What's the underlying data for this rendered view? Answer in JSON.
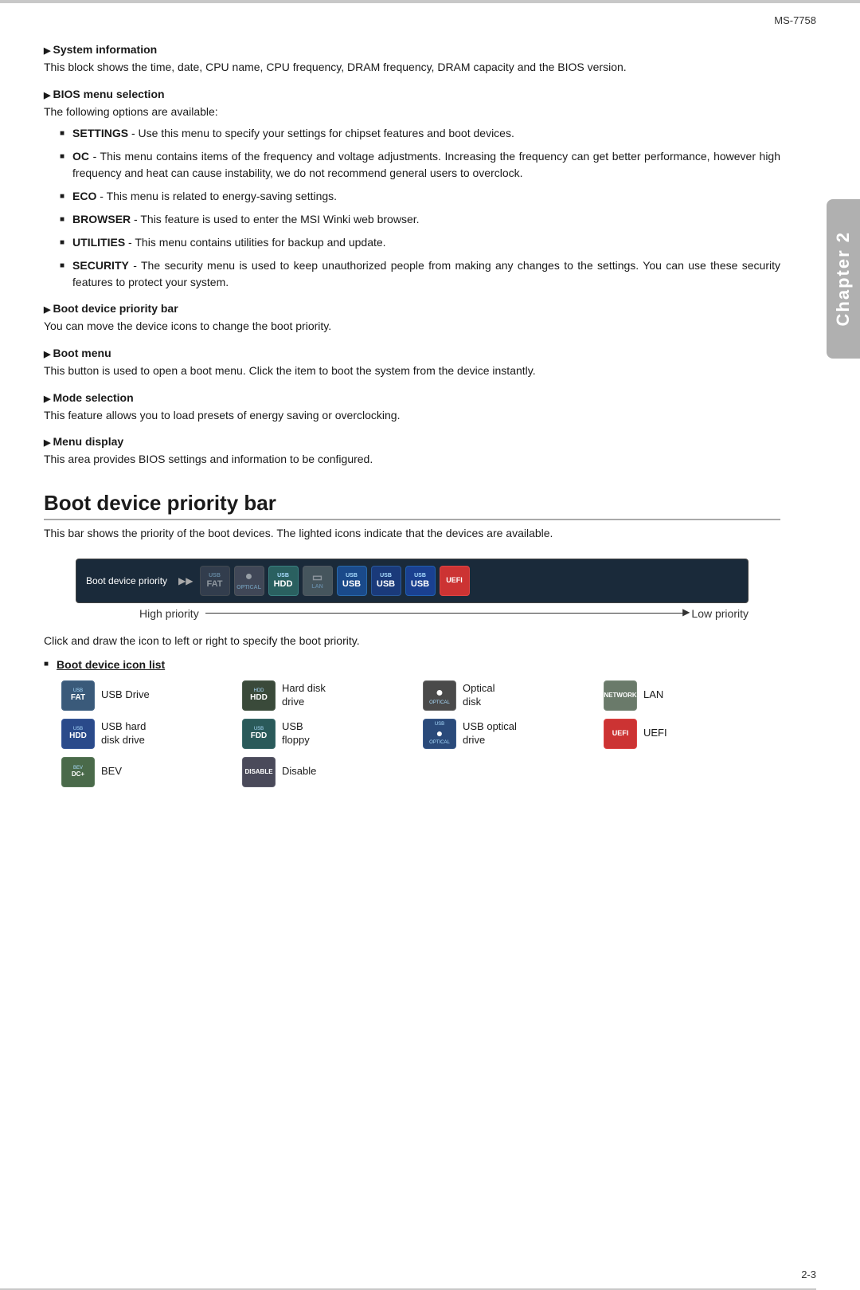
{
  "meta": {
    "model": "MS-7758",
    "chapter": "Chapter 2",
    "page_number": "2-3"
  },
  "sections": {
    "system_information": {
      "header": "System information",
      "body": "This block shows the time, date, CPU name, CPU frequency, DRAM frequency, DRAM capacity and the BIOS version."
    },
    "bios_menu_selection": {
      "header": "BIOS menu selection",
      "intro": "The following options are available:",
      "items": [
        {
          "term": "SETTINGS",
          "desc": " - Use this menu to specify your settings for chipset features and boot devices."
        },
        {
          "term": "OC",
          "desc": " - This menu contains items of the frequency and voltage adjustments. Increasing the frequency can get better performance, however high frequency and heat can cause instability, we do not recommend general users to overclock."
        },
        {
          "term": "ECO",
          "desc": " - This menu is related to energy-saving settings."
        },
        {
          "term": "BROWSER",
          "desc": " - This feature is used to enter the MSI Winki web browser."
        },
        {
          "term": "UTILITIES",
          "desc": " - This menu contains utilities for backup and update."
        },
        {
          "term": "SECURITY",
          "desc": " - The security menu is used to keep unauthorized people from making any changes to the settings. You can use these security features to protect your system."
        }
      ]
    },
    "boot_device_priority_bar_mini": {
      "header": "Boot device priority bar",
      "body": "You can move the device icons to change the boot priority."
    },
    "boot_menu": {
      "header": "Boot menu",
      "body": "This button is used to open a boot menu. Click the item to boot the system from the device instantly."
    },
    "mode_selection": {
      "header": "Mode selection",
      "body": "This feature allows you to load presets of energy saving or overclocking."
    },
    "menu_display": {
      "header": "Menu display",
      "body": "This area provides BIOS settings and information to be configured."
    }
  },
  "main_section": {
    "title": "Boot device priority bar",
    "intro": "This bar shows the priority of the boot devices. The lighted icons indicate that the devices are available.",
    "bar": {
      "label": "Boot device priority",
      "arrows": "▶▶",
      "icons": [
        {
          "type": "usb-drive",
          "top": "USB",
          "main": "FAT",
          "color": "dark-gray",
          "dim": true
        },
        {
          "type": "optical",
          "top": "",
          "main": "●",
          "color": "med-gray",
          "dim": true
        },
        {
          "type": "usb-hdd",
          "top": "USB",
          "main": "HDD",
          "color": "teal",
          "dim": false
        },
        {
          "type": "file",
          "top": "",
          "main": "□",
          "color": "gray-light",
          "dim": true
        },
        {
          "type": "usb1",
          "top": "USB",
          "main": "USB",
          "color": "blue-usb",
          "dim": false
        },
        {
          "type": "usb2",
          "top": "USB",
          "main": "USB",
          "color": "blue-usb2",
          "dim": false
        },
        {
          "type": "usb3",
          "top": "USB",
          "main": "USB",
          "color": "blue-usb3",
          "dim": false
        },
        {
          "type": "uefi",
          "top": "",
          "main": "UEFI",
          "color": "uefi",
          "dim": false
        }
      ]
    },
    "priority_high": "High priority",
    "priority_low": "Low priority",
    "click_instruction": "Click and draw the icon to left or right to specify the boot priority.",
    "icon_list_header": "Boot device icon list",
    "icon_list": [
      {
        "id": "usb-drive",
        "label": "USB Drive",
        "color": "si-usb-drive",
        "top": "USB",
        "main": "FAT",
        "bot": ""
      },
      {
        "id": "hdd",
        "label": "Hard disk\ndrive",
        "color": "si-hdd",
        "top": "HDD",
        "main": "HDD",
        "bot": ""
      },
      {
        "id": "optical",
        "label": "Optical\ndisk",
        "color": "si-optical",
        "top": "",
        "main": "●",
        "bot": "OPTICAL"
      },
      {
        "id": "lan",
        "label": "LAN",
        "color": "si-lan",
        "top": "",
        "main": "LAN",
        "bot": "NETWORK"
      },
      {
        "id": "usb-hdd",
        "label": "USB hard\ndisk drive",
        "color": "si-usb-hdd",
        "top": "USB",
        "main": "HDD",
        "bot": ""
      },
      {
        "id": "usb-floppy",
        "label": "USB\nfloppy",
        "color": "si-usb-floppy",
        "top": "USB",
        "main": "FDD",
        "bot": ""
      },
      {
        "id": "usb-optical",
        "label": "USB optical\ndrive",
        "color": "si-usb-optical",
        "top": "USB",
        "main": "OPT",
        "bot": "OPTICAL"
      },
      {
        "id": "uefi",
        "label": "UEFI",
        "color": "si-uefi",
        "top": "",
        "main": "UEFI",
        "bot": ""
      },
      {
        "id": "bev",
        "label": "BEV",
        "color": "si-bev",
        "top": "BEV",
        "main": "BEV",
        "bot": ""
      },
      {
        "id": "disable",
        "label": "Disable",
        "color": "si-disable",
        "top": "",
        "main": "DIS",
        "bot": "DISABLE"
      }
    ]
  }
}
